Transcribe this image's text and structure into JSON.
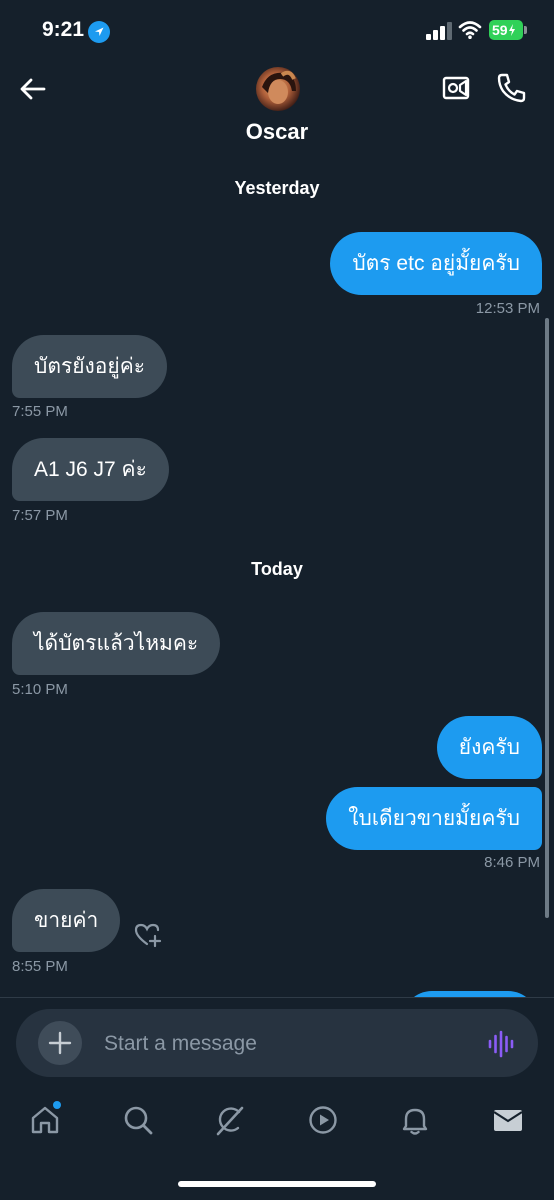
{
  "status_bar": {
    "time": "9:21",
    "battery": "59"
  },
  "header": {
    "contact_name": "Oscar"
  },
  "conversation": {
    "sections": [
      {
        "label": "Yesterday"
      },
      {
        "label": "Today"
      }
    ],
    "messages": [
      {
        "direction": "outgoing",
        "text": "บัตร etc อยู่มั้ยครับ",
        "time": "12:53 PM"
      },
      {
        "direction": "incoming",
        "text": "บัตรยังอยู่ค่ะ",
        "time": "7:55 PM"
      },
      {
        "direction": "incoming",
        "text": "A1 J6 J7 ค่ะ",
        "time": "7:57 PM"
      },
      {
        "direction": "incoming",
        "text": "ได้บัตรแล้วไหมคะ",
        "time": "5:10 PM"
      },
      {
        "direction": "outgoing",
        "text": "ยังครับ",
        "time": ""
      },
      {
        "direction": "outgoing",
        "text": "ใบเดียวขายมั้ยครับ",
        "time": "8:46 PM"
      },
      {
        "direction": "incoming",
        "text": "ขายค่า",
        "time": "8:55 PM"
      }
    ]
  },
  "composer": {
    "placeholder": "Start a message"
  },
  "bottom_nav": {
    "items": [
      {
        "icon": "home-icon",
        "badge": true
      },
      {
        "icon": "search-icon"
      },
      {
        "icon": "grok-icon"
      },
      {
        "icon": "video-play-icon"
      },
      {
        "icon": "notifications-bell-icon"
      },
      {
        "icon": "messages-mail-icon"
      }
    ]
  },
  "colors": {
    "background": "#15202b",
    "outgoing_bubble": "#1d9bf0",
    "incoming_bubble": "#3d4b57",
    "timestamp": "#8b98a5",
    "voice_accent": "#8b5cf6"
  }
}
